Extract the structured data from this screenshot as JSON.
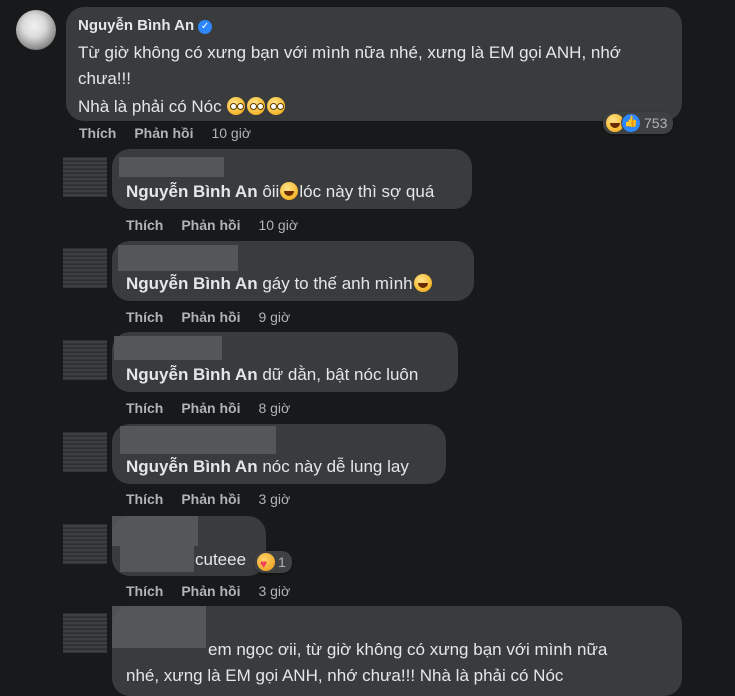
{
  "main_comment": {
    "author": "Nguyễn Bình An",
    "line1": "Từ giờ không có xưng bạn với mình nữa nhé, xưng là EM gọi ANH, nhớ",
    "line2": "chưa!!!",
    "line3": "Nhà là phải có Nóc",
    "reaction_count": "753",
    "like_label": "Thích",
    "reply_label": "Phản hồi",
    "time": "10 giờ"
  },
  "replies": [
    {
      "author": "Nguyễn Bình An",
      "text_a": "ôii",
      "text_b": "lóc này thì sợ quá",
      "like": "Thích",
      "reply": "Phản hồi",
      "time": "10 giờ"
    },
    {
      "author": "Nguyễn Bình An",
      "text_a": "gáy to thế anh mình",
      "like": "Thích",
      "reply": "Phản hồi",
      "time": "9 giờ"
    },
    {
      "author": "Nguyễn Bình An",
      "text_a": "dữ dằn, bật nóc luôn",
      "like": "Thích",
      "reply": "Phản hồi",
      "time": "8 giờ"
    },
    {
      "author": "Nguyễn Bình An",
      "text_a": "nóc này dễ lung lay",
      "like": "Thích",
      "reply": "Phản hồi",
      "time": "3 giờ"
    },
    {
      "text_a": "cuteee",
      "reaction_count": "1",
      "like": "Thích",
      "reply": "Phản hồi",
      "time": "3 giờ"
    },
    {
      "line1": "em ngọc ơii, từ giờ không có xưng bạn với mình nữa",
      "line2": "nhé, xưng là EM gọi ANH, nhớ chưa!!! Nhà là phải có Nóc"
    }
  ],
  "icons": {
    "verified": "verified-badge-icon",
    "haha": "haha-reaction-icon",
    "like": "like-reaction-icon",
    "care": "care-reaction-icon"
  }
}
